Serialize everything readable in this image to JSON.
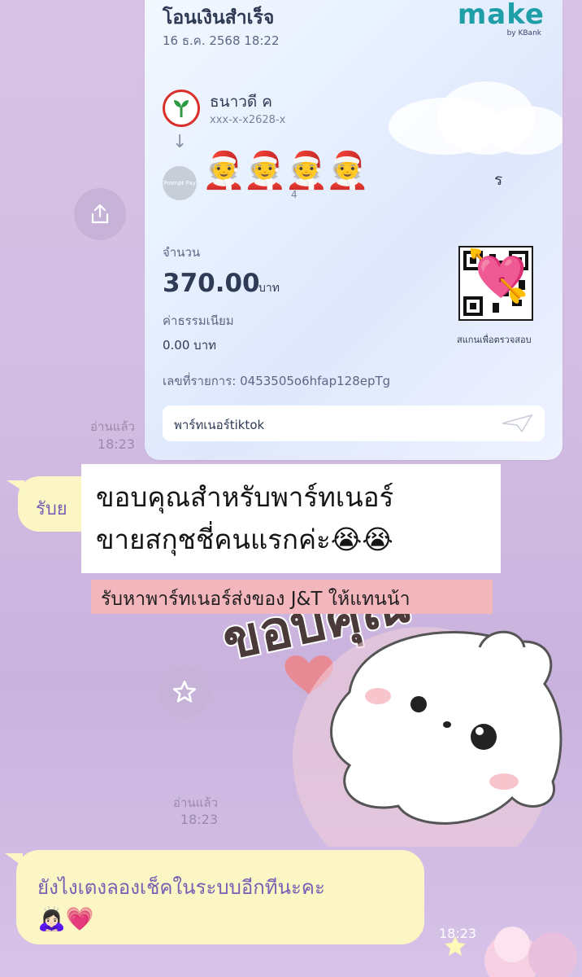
{
  "receipt": {
    "title": "โอนเงินสำเร็จ",
    "date": "16 ธ.ค. 2568 18:22",
    "logo": "make",
    "logo_sub": "by KBank",
    "from_name": "ธนาวดี ค",
    "from_account": "xxx-x-x2628-x",
    "to_name_suffix": "ร",
    "to_account_suffix": "4",
    "promptpay_label": "Prompt Pay",
    "cover_emoji": "🧑‍🎄🧑‍🎄🧑‍🎄🧑‍🎄",
    "amount_label": "จำนวน",
    "amount": "370.00",
    "amount_unit": "บาท",
    "fee_label": "ค่าธรรมเนียม",
    "fee": "0.00 บาท",
    "reference": "เลขที่รายการ: 0453505o6hfap128epTg",
    "qr_cover_emoji": "💘",
    "scan_label": "สแกนเพื่อตรวจสอบ",
    "memo": "พาร์ทเนอร์tiktok"
  },
  "chat": {
    "read_1": "อ่านแล้ว",
    "time_1": "18:23",
    "bubble_1": "รับย",
    "read_2": "อ่านแล้ว",
    "time_2": "18:23",
    "bubble_2": "ยังไงเตงลองเช็คในระบบอีกทีนะคะ",
    "bubble_2_emoji": "🙇🏻‍♀️💗",
    "time_3": "18:23"
  },
  "caption": {
    "line1": "ขอบคุณสำหรับพาร์ทเนอร์",
    "line2": "ขายสกุชชี่คนแรกค่ะ😭😭",
    "sub": "รับหาพาร์ทเนอร์ส่งของ J&T ให้แทนน้า"
  },
  "icons": {
    "share": "share-icon",
    "star": "star-icon",
    "send": "paper-plane-icon"
  }
}
